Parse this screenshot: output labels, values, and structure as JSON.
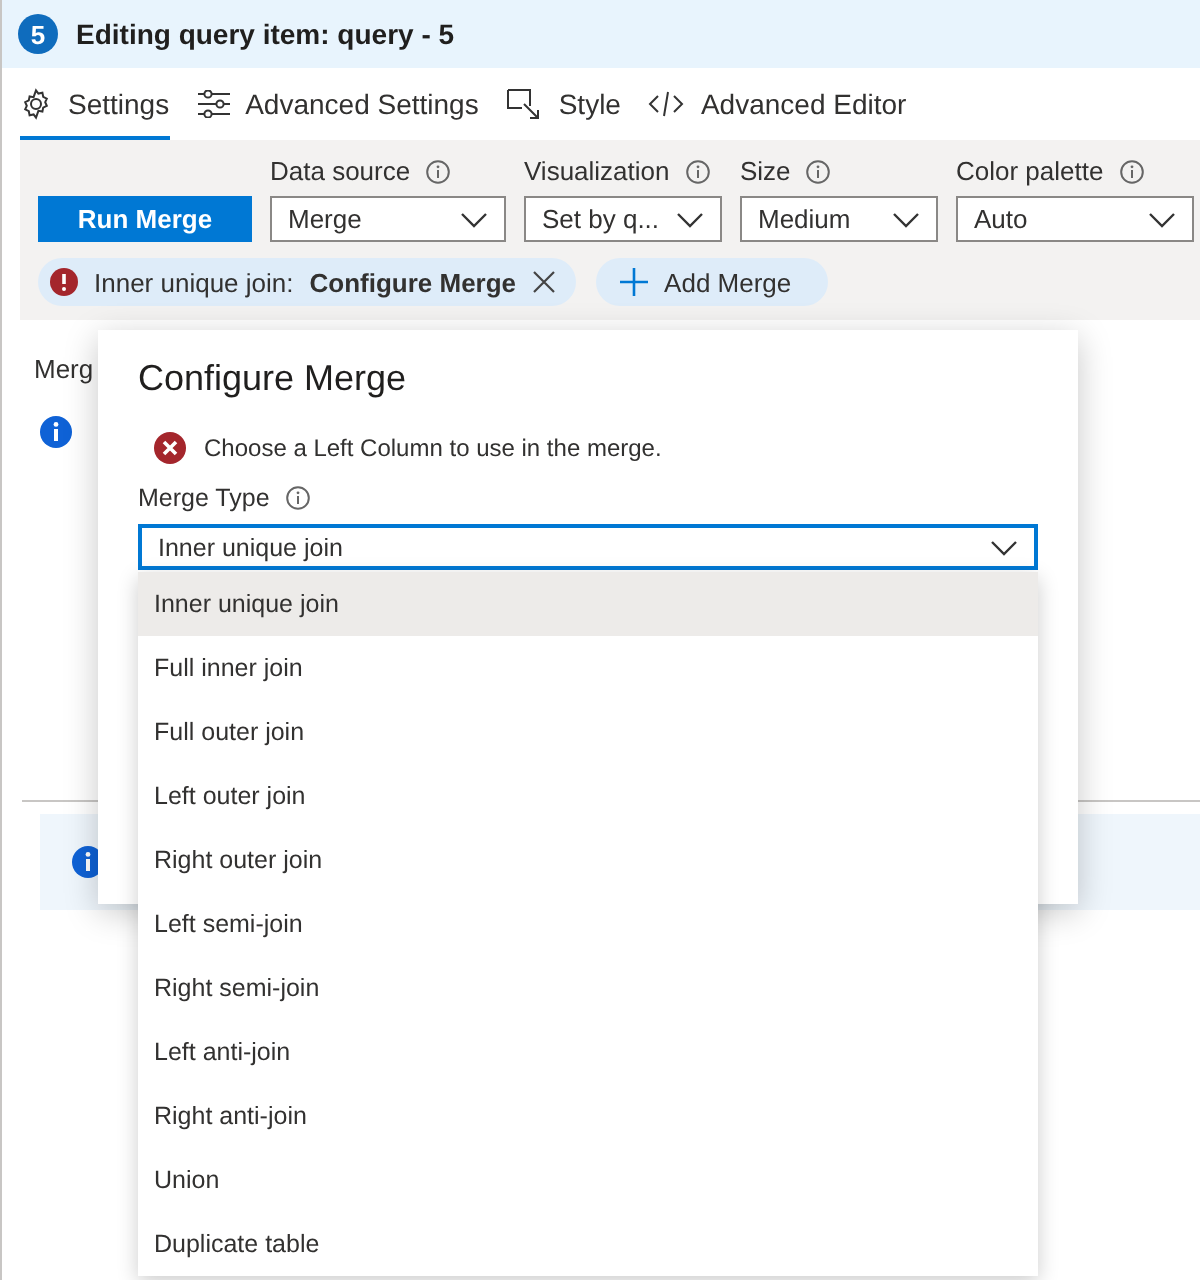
{
  "header": {
    "badge": "5",
    "title": "Editing query item: query - 5"
  },
  "tabs": [
    {
      "kind": "gear",
      "label": "Settings",
      "selected": true
    },
    {
      "kind": "sliders",
      "label": "Advanced Settings",
      "selected": false
    },
    {
      "kind": "style",
      "label": "Style",
      "selected": false
    },
    {
      "kind": "code",
      "label": "Advanced Editor",
      "selected": false
    }
  ],
  "toolbar": {
    "run_button": "Run Merge",
    "fields": [
      {
        "label": "Data source",
        "value": "Merge"
      },
      {
        "label": "Visualization",
        "value": "Set by q..."
      },
      {
        "label": "Size",
        "value": "Medium"
      },
      {
        "label": "Color palette",
        "value": "Auto"
      }
    ]
  },
  "merge_chips": [
    {
      "kind": "merge",
      "prefix": "Inner unique join:",
      "name": "Configure Merge"
    },
    {
      "kind": "add",
      "label": "Add Merge"
    }
  ],
  "background": {
    "section_label": "Merg"
  },
  "dialog": {
    "title": "Configure Merge",
    "error": "Choose a Left Column to use in the merge.",
    "merge_type": {
      "label": "Merge Type",
      "value": "Inner unique join",
      "expanded": true,
      "options": [
        {
          "label": "Inner unique join",
          "selected": true
        },
        {
          "label": "Full inner join",
          "selected": false
        },
        {
          "label": "Full outer join",
          "selected": false
        },
        {
          "label": "Left outer join",
          "selected": false
        },
        {
          "label": "Right outer join",
          "selected": false
        },
        {
          "label": "Left semi-join",
          "selected": false
        },
        {
          "label": "Right semi-join",
          "selected": false
        },
        {
          "label": "Left anti-join",
          "selected": false
        },
        {
          "label": "Right anti-join",
          "selected": false
        },
        {
          "label": "Union",
          "selected": false
        },
        {
          "label": "Duplicate table",
          "selected": false
        }
      ]
    }
  }
}
